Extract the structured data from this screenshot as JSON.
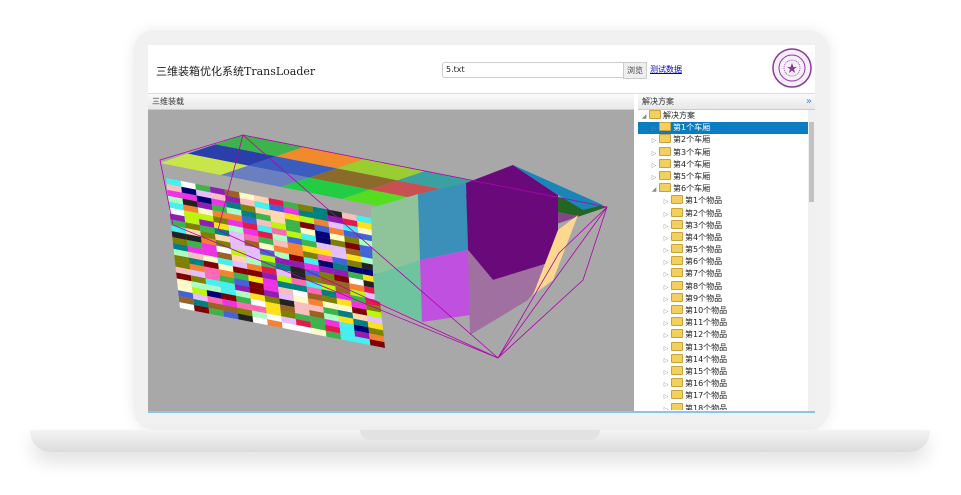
{
  "header": {
    "title": "三维装箱优化系统TransLoader",
    "file_value": "5.txt",
    "browse_label": "浏览",
    "test_data_link": "测试数据",
    "logo": "university-seal"
  },
  "left_panel": {
    "title": "三维装载"
  },
  "right_panel": {
    "title": "解决方案",
    "collapse_icon": "double-chevron-right"
  },
  "tree": {
    "root": "解决方案",
    "selected": "第1个车厢",
    "vehicles": [
      "第1个车厢",
      "第2个车厢",
      "第3个车厢",
      "第4个车厢",
      "第5个车厢",
      "第6个车厢"
    ],
    "items": [
      "第1个物品",
      "第2个物品",
      "第3个物品",
      "第4个物品",
      "第5个物品",
      "第6个物品",
      "第7个物品",
      "第8个物品",
      "第9个物品",
      "第10个物品",
      "第11个物品",
      "第12个物品",
      "第13个物品",
      "第14个物品",
      "第15个物品",
      "第16个物品",
      "第17个物品",
      "第18个物品"
    ]
  },
  "scene": {
    "background": "#a8a8a8",
    "outline": "#b000b0",
    "palette": [
      "#e6194b",
      "#3cb44b",
      "#ffe119",
      "#4363d8",
      "#f58231",
      "#911eb4",
      "#46f0f0",
      "#f032e6",
      "#bcf60c",
      "#fabebe",
      "#008080",
      "#e6beff",
      "#9a6324",
      "#fffac8",
      "#800000",
      "#aaffc3",
      "#808000",
      "#ffd8b1",
      "#000075",
      "#ffffff",
      "#222222",
      "#ff69b4"
    ],
    "top_blocks": [
      "#3cb44b",
      "#2a3faa",
      "#c8e64a",
      "#f08a2a",
      "#3a5dbf",
      "#6a7fbf",
      "#9acd32",
      "#8b6b2a",
      "#22cc44",
      "#3aa0a0",
      "#c85050",
      "#55dd22",
      "#44e0b0",
      "#1e3f7a",
      "#1090c0",
      "#226622",
      "#884488",
      "#40c0a0"
    ]
  }
}
